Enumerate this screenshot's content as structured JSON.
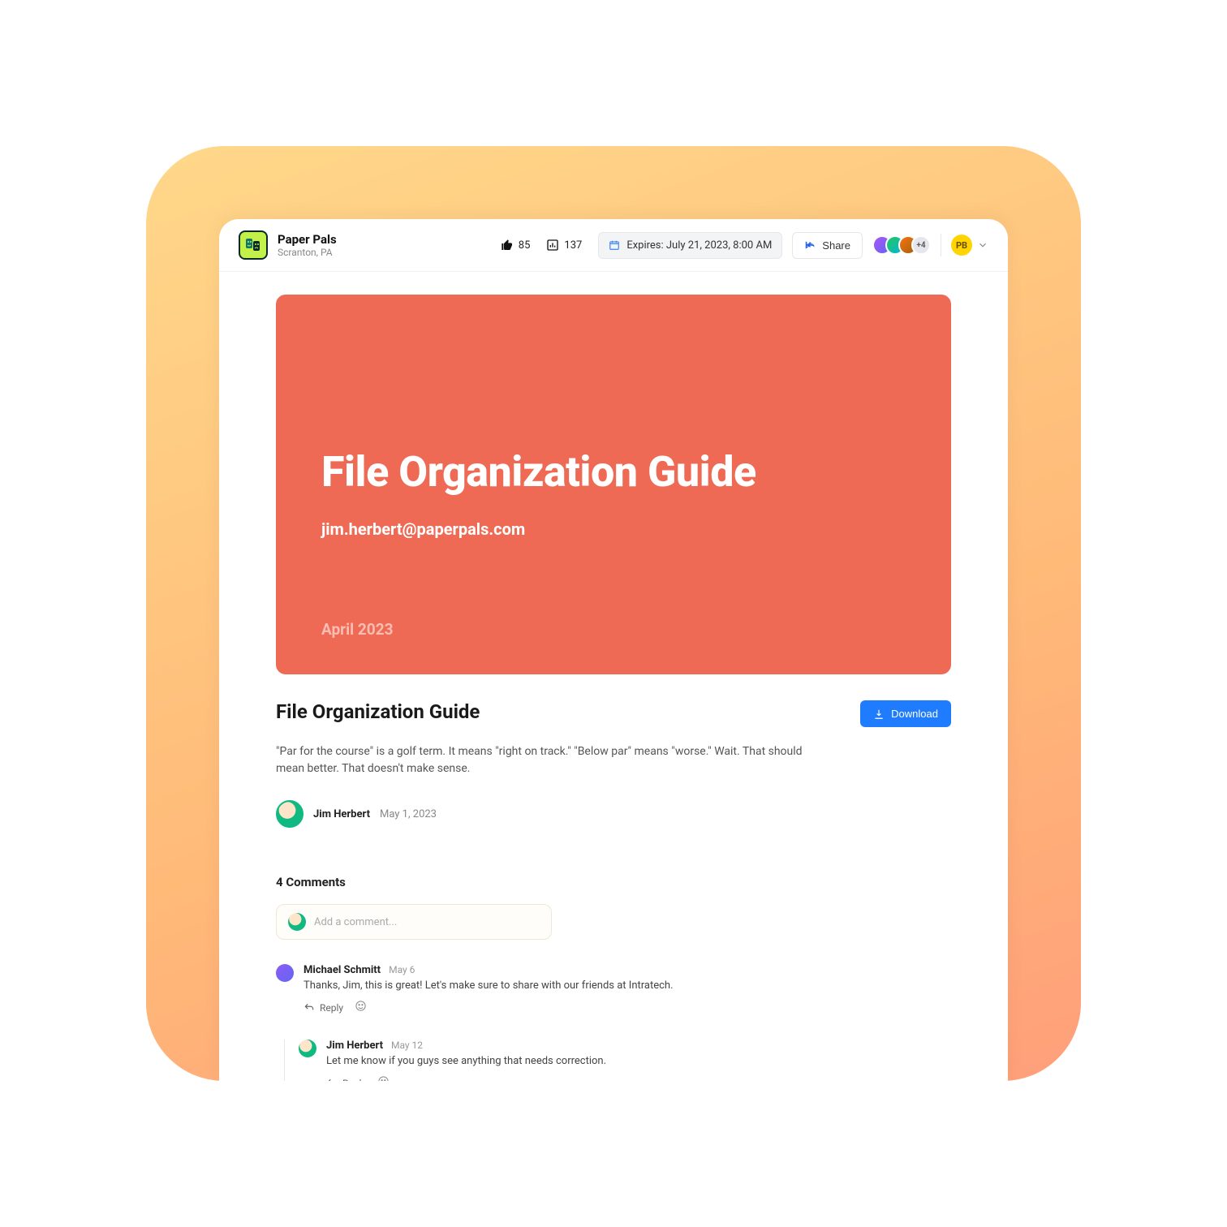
{
  "header": {
    "org_name": "Paper Pals",
    "org_location": "Scranton, PA",
    "likes": "85",
    "views": "137",
    "expires_label": "Expires: July 21, 2023, 8:00 AM",
    "share_label": "Share",
    "more_avatars": "+4",
    "profile_initials": "PB"
  },
  "hero": {
    "title": "File Organization Guide",
    "subtitle": "jim.herbert@paperpals.com",
    "date": "April 2023"
  },
  "doc": {
    "title": "File Organization Guide",
    "download_label": "Download",
    "description": "\"Par for the course\" is a golf term. It means \"right on track.\" \"Below par\" means \"worse.\" Wait. That should mean better. That doesn't make sense.",
    "author_name": "Jim Herbert",
    "author_date": "May 1, 2023"
  },
  "comments": {
    "heading": "4 Comments",
    "placeholder": "Add a comment...",
    "reply_label": "Reply",
    "items": [
      {
        "name": "Michael Schmitt",
        "date": "May 6",
        "text": "Thanks, Jim, this is great! Let's make sure to share with our friends at Intratech."
      },
      {
        "name": "Jim Herbert",
        "date": "May 12",
        "text": "Let me know if you guys see anything that needs correction."
      }
    ]
  }
}
